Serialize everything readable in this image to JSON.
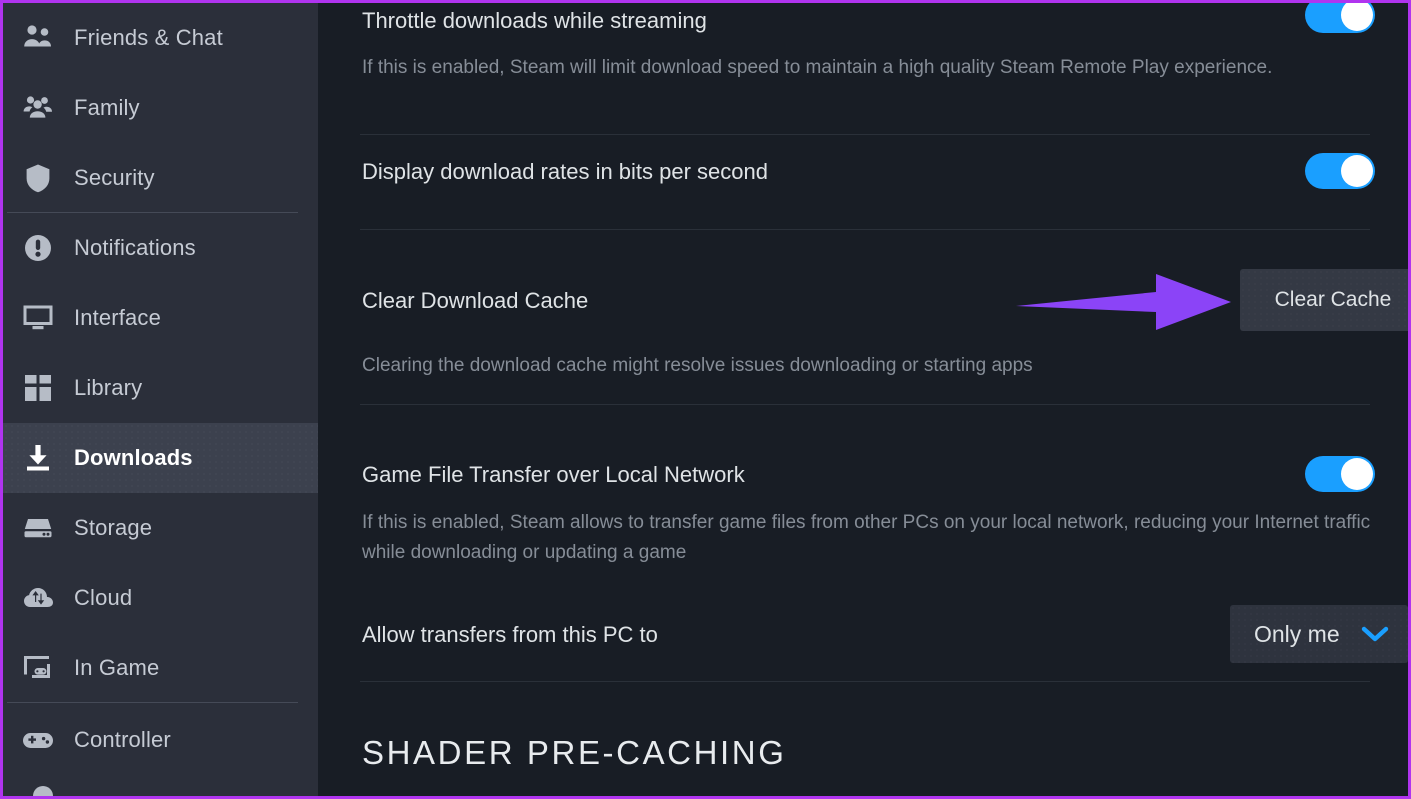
{
  "window": {
    "accent_border_color": "#b034ef",
    "sidebar_bg": "#2b2f3a",
    "content_bg": "#181d25",
    "toggle_on_color": "#1a9fff",
    "dropdown_chevron_color": "#1a9fff",
    "annotation_arrow_color": "#8b44f7"
  },
  "sidebar": {
    "items": [
      {
        "label": "Friends & Chat",
        "icon": "friends-icon",
        "active": false
      },
      {
        "label": "Family",
        "icon": "family-icon",
        "active": false
      },
      {
        "label": "Security",
        "icon": "shield-icon",
        "active": false
      },
      {
        "label": "Notifications",
        "icon": "notifications-icon",
        "active": false
      },
      {
        "label": "Interface",
        "icon": "monitor-icon",
        "active": false
      },
      {
        "label": "Library",
        "icon": "grid-icon",
        "active": false
      },
      {
        "label": "Downloads",
        "icon": "download-icon",
        "active": true
      },
      {
        "label": "Storage",
        "icon": "drive-icon",
        "active": false
      },
      {
        "label": "Cloud",
        "icon": "cloud-sync-icon",
        "active": false
      },
      {
        "label": "In Game",
        "icon": "in-game-icon",
        "active": false
      },
      {
        "label": "Controller",
        "icon": "gamepad-icon",
        "active": false
      }
    ]
  },
  "main": {
    "settings": [
      {
        "title": "Throttle downloads while streaming",
        "desc": "If this is enabled, Steam will limit download speed to maintain a high quality Steam Remote Play experience.",
        "control": "toggle",
        "toggle_on": true
      },
      {
        "title": "Display download rates in bits per second",
        "desc": "",
        "control": "toggle",
        "toggle_on": true
      },
      {
        "title": "Clear Download Cache",
        "desc": "Clearing the download cache might resolve issues downloading or starting apps",
        "control": "button",
        "button_label": "Clear Cache"
      },
      {
        "title": "Game File Transfer over Local Network",
        "desc": "If this is enabled, Steam allows to transfer game files from other PCs on your local network, reducing your Internet traffic while downloading or updating a game",
        "control": "toggle",
        "toggle_on": true
      },
      {
        "title": "Allow transfers from this PC to",
        "desc": "",
        "control": "dropdown",
        "dropdown_value": "Only me"
      }
    ],
    "section_heading": "SHADER PRE-CACHING"
  }
}
